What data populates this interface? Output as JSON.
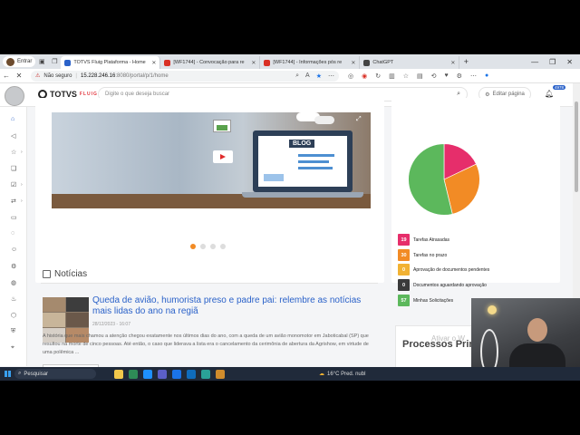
{
  "browser": {
    "profile_label": "Entrar",
    "tabs": [
      {
        "title": "TOTVS Fluig Plataforma - Home",
        "active": true,
        "fav_color": "#2b62c9"
      },
      {
        "title": "[WF1744] - Convocação para re",
        "active": false,
        "fav_color": "#d93025"
      },
      {
        "title": "[WF1744] - Informações pós re",
        "active": false,
        "fav_color": "#d93025"
      },
      {
        "title": "ChatGPT",
        "active": false,
        "fav_color": "#444444"
      }
    ],
    "new_tab": "+",
    "security_label": "Não seguro",
    "url_host": "15.228.246.16",
    "url_path": ":8080/portal/p/1/home"
  },
  "header": {
    "logo_text": "TOTVS",
    "logo_sub": "FLUIG",
    "search_placeholder": "Digite o que deseja buscar",
    "edit_page_label": "Editar página",
    "notif_count": "4978"
  },
  "main": {
    "banner_tag": "BLOG",
    "carousel_dots": 4,
    "news_heading": "Notícias",
    "news_title": "Queda de avião, humorista preso e padre pai: relembre as notícias mais lidas do ano na regiã",
    "news_date": "28/12/2023 - 16:07",
    "news_text": "A história que mais chamou a atenção chegou exatamente nos últimos dias do ano, com a queda de um avião monomotor em Jaboticabal (SP) que resultou na morte de cinco pessoas. Até então, o caso que liderava a lista era o cancelamento da cerimônia de abertura da Agrishow, em virtude de uma polêmica ..."
  },
  "tasks": {
    "chart_data": {
      "type": "pie",
      "values": [
        19,
        30,
        0,
        0,
        57
      ],
      "colors": [
        "#e62e6b",
        "#f28b25",
        "#f2b233",
        "#3a3a3a",
        "#5cb85c"
      ]
    },
    "legend": [
      {
        "count": "19",
        "label": "Tarefas Atrasadas",
        "color": "#e62e6b"
      },
      {
        "count": "30",
        "label": "Tarefas no prazo",
        "color": "#f28b25"
      },
      {
        "count": "0",
        "label": "Aprovação de documentos pendentes",
        "color": "#f2b233"
      },
      {
        "count": "0",
        "label": "Documentos aguardando aprovação",
        "color": "#3a3a3a"
      },
      {
        "count": "57",
        "label": "Minhas Solicitações",
        "color": "#5cb85c"
      }
    ],
    "processes_title": "Processos Prin",
    "watermark": "Ativar o W"
  },
  "taskbar": {
    "search_label": "Pesquisar",
    "weather": "16°C  Pred. nubl"
  },
  "icons": [
    "search-icon",
    "bell-icon",
    "edit-icon",
    "home-icon",
    "expand-icon",
    "refresh-icon",
    "back-icon"
  ]
}
